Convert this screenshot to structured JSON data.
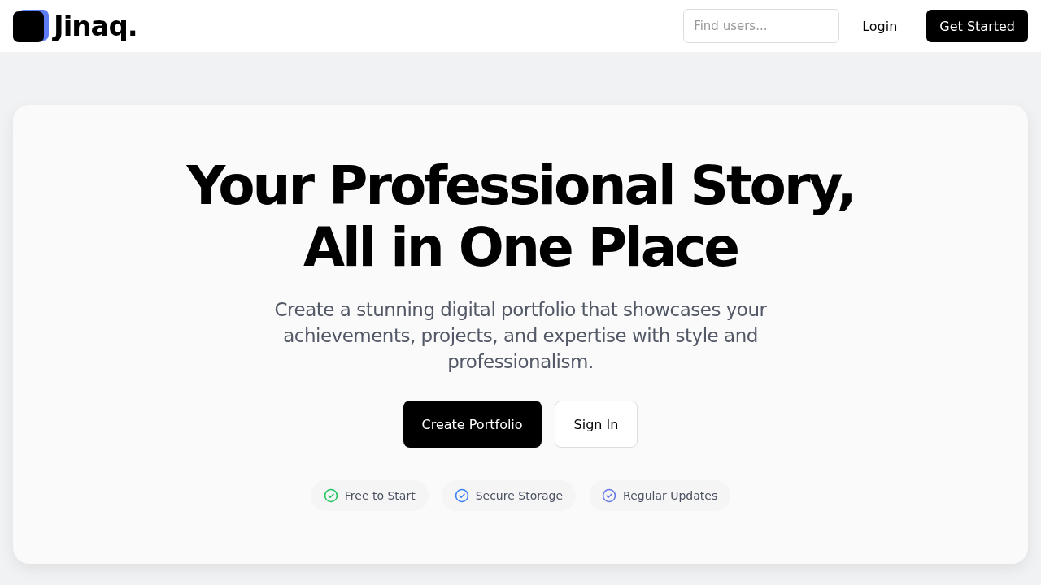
{
  "header": {
    "logo": "Jinaq.",
    "search": {
      "placeholder": "Find users..."
    },
    "login": "Login",
    "cta": "Get Started"
  },
  "hero": {
    "title_lines": [
      "Your Professional Story,",
      "All in One Place"
    ],
    "subtitle": "Create a stunning digital portfolio that showcases your achievements, projects, and expertise with style and professionalism.",
    "buttons": [
      {
        "label": "Create Portfolio",
        "kind": "primary"
      },
      {
        "label": "Sign In",
        "kind": "secondary"
      }
    ],
    "features": [
      {
        "label": "Free to Start",
        "color": "#22c55e"
      },
      {
        "label": "Secure Storage",
        "color": "#3b82f6"
      },
      {
        "label": "Regular Updates",
        "color": "#6478e8"
      }
    ]
  }
}
